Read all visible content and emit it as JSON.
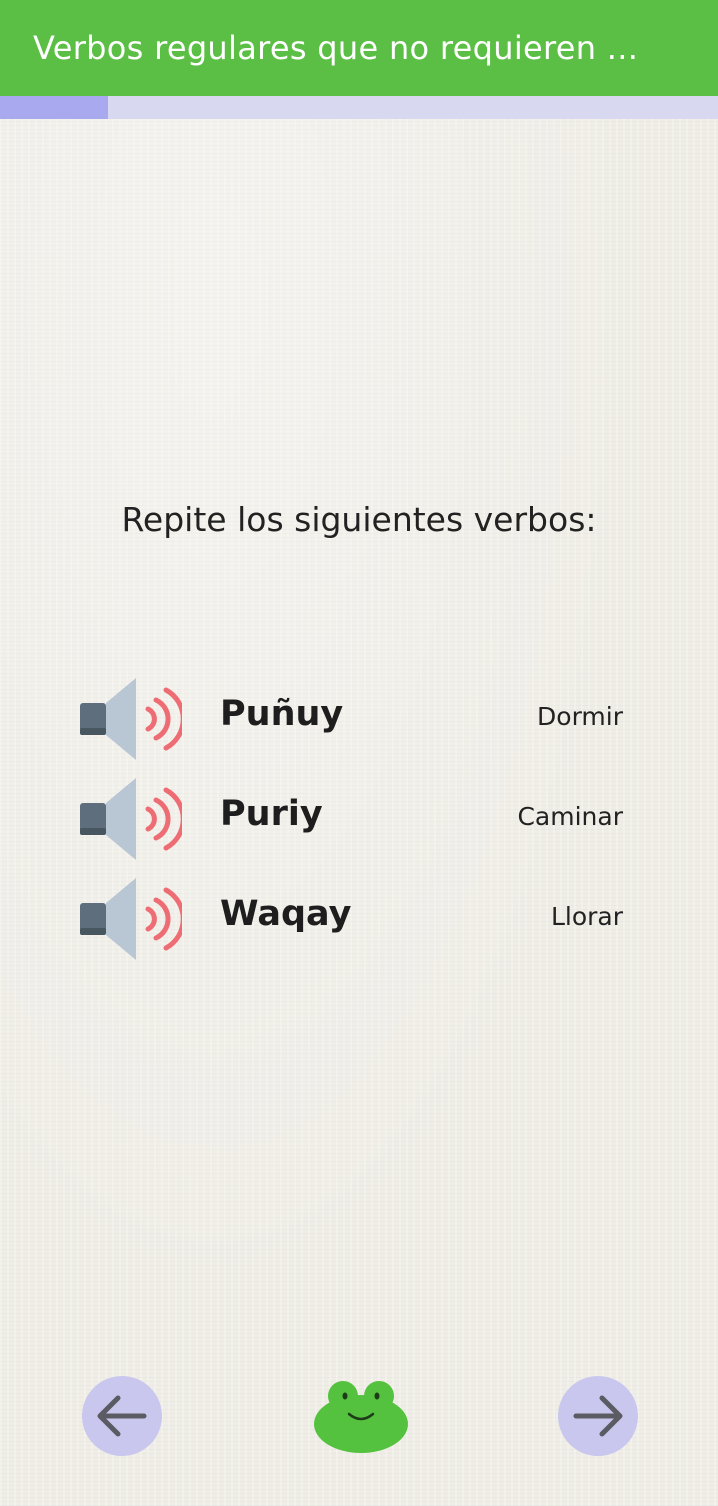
{
  "header": {
    "title": "Verbos  regulares que no requieren ...",
    "background_color": "#5cbf45"
  },
  "progress": {
    "fraction": 0.15,
    "track_color": "#d8d8f0",
    "fill_color": "#a9a9f0"
  },
  "instruction": "Repite los siguientes verbos:",
  "verbs": [
    {
      "word": "Puñuy",
      "meaning": "Dormir",
      "icon": "speaker-icon"
    },
    {
      "word": "Puriy",
      "meaning": "Caminar",
      "icon": "speaker-icon"
    },
    {
      "word": "Waqay",
      "meaning": "Llorar",
      "icon": "speaker-icon"
    }
  ],
  "footer": {
    "back_icon": "arrow-left-icon",
    "next_icon": "arrow-right-icon",
    "mascot_icon": "frog-icon",
    "button_color": "#c9c7ee",
    "mascot_color": "#55c23f"
  }
}
